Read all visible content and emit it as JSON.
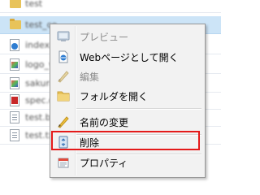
{
  "file_list": {
    "rows": [
      {
        "name": "test",
        "type": "folder",
        "selected": false
      },
      {
        "name": "test_co",
        "type": "folder",
        "selected": true
      },
      {
        "name": "index.htm",
        "type": "html",
        "selected": false
      },
      {
        "name": "logo_ver",
        "type": "image",
        "selected": false
      },
      {
        "name": "sakura_c",
        "type": "image",
        "selected": false
      },
      {
        "name": "spec.cop",
        "type": "pdf",
        "selected": false
      },
      {
        "name": "test.bat",
        "type": "text",
        "selected": false
      },
      {
        "name": "test.txt",
        "type": "text",
        "selected": false
      }
    ]
  },
  "context_menu": {
    "items": [
      {
        "label": "プレビュー",
        "icon": "monitor-icon",
        "enabled": false
      },
      {
        "label": "Webページとして開く",
        "icon": "ie-page-icon",
        "enabled": true
      },
      {
        "label": "編集",
        "icon": "pencil-icon",
        "enabled": false
      },
      {
        "label": "フォルダを開く",
        "icon": "folder-icon",
        "enabled": true
      },
      {
        "label": "名前の変更",
        "icon": "pencil-icon",
        "enabled": true
      },
      {
        "label": "削除",
        "icon": "recycle-bin-icon",
        "enabled": true,
        "highlighted": true
      },
      {
        "label": "プロパティ",
        "icon": "properties-icon",
        "enabled": true
      }
    ]
  },
  "colors": {
    "highlight_border": "#e41a1a",
    "selection_background": "#cce4f7"
  }
}
